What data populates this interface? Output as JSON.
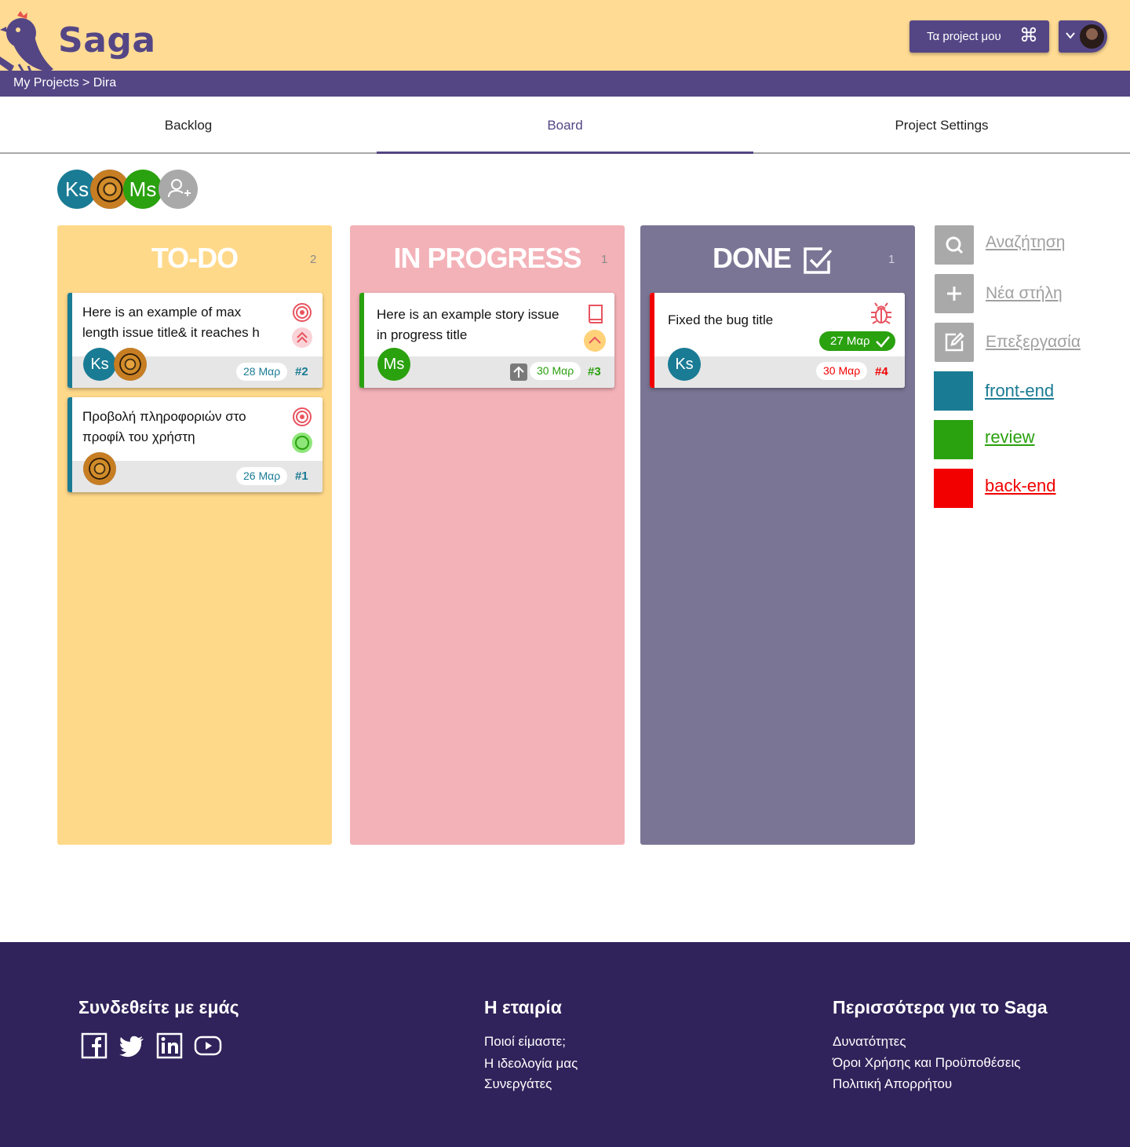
{
  "header": {
    "logo_text": "Saga",
    "projects_button": "Τα project μου",
    "projects_icon": "⌘"
  },
  "breadcrumb": "My Projects > Dira",
  "tabs": [
    {
      "label": "Backlog",
      "active": false
    },
    {
      "label": "Board",
      "active": true
    },
    {
      "label": "Project Settings",
      "active": false
    }
  ],
  "members": [
    {
      "initials": "Ks",
      "color": "#1a7b94"
    },
    {
      "initials": "",
      "type": "photo"
    },
    {
      "initials": "Ms",
      "color": "#2aa10f"
    },
    {
      "type": "add-member"
    }
  ],
  "columns": [
    {
      "title": "TO-DO",
      "count": "2",
      "color": "#ffd98a"
    },
    {
      "title": "IN PROGRESS",
      "count": "1",
      "color": "#f3b2b8"
    },
    {
      "title": "DONE",
      "count": "1",
      "color": "#7b7595"
    }
  ],
  "cards": {
    "todo_1": {
      "title": "Here is an example of max length issue title& it reaches h",
      "date": "28 Μαρ",
      "number": "#2",
      "avatar": "Ks",
      "stripe": "#1a7b94"
    },
    "todo_2": {
      "title": "Προβολή πληροφοριών στο προφίλ του χρήστη",
      "date": "26 Μαρ",
      "number": "#1",
      "stripe": "#1a7b94"
    },
    "progress_1": {
      "title": "Here is an example story issue in progress title",
      "date": "30 Μαρ",
      "number": "#3",
      "avatar": "Ms",
      "stripe": "#2aa10f"
    },
    "done_1": {
      "title": "Fixed the bug title",
      "completed_date": "27 Μαρ",
      "date": "30 Μαρ",
      "number": "#4",
      "avatar": "Ks",
      "stripe": "#f20000"
    }
  },
  "sidebar": {
    "search": "Αναζήτηση",
    "new_column": "Νέα στήλη",
    "edit": "Επεξεργασία"
  },
  "labels": [
    {
      "name": "front-end",
      "color": "#1a7b94"
    },
    {
      "name": "review",
      "color": "#2aa10f"
    },
    {
      "name": "back-end",
      "color": "#f20000"
    }
  ],
  "footer": {
    "connect_title": "Συνδεθείτε με εμάς",
    "company_title": "Η εταιρία",
    "company_links": [
      "Ποιοί είμαστε;",
      "Η ιδεολογία μας",
      "Συνεργάτες"
    ],
    "more_title": "Περισσότερα για το Saga",
    "more_links": [
      "Δυνατότητες",
      "Όροι Χρήσης και Προϋποθέσεις",
      "Πολιτική Απορρήτου"
    ]
  }
}
